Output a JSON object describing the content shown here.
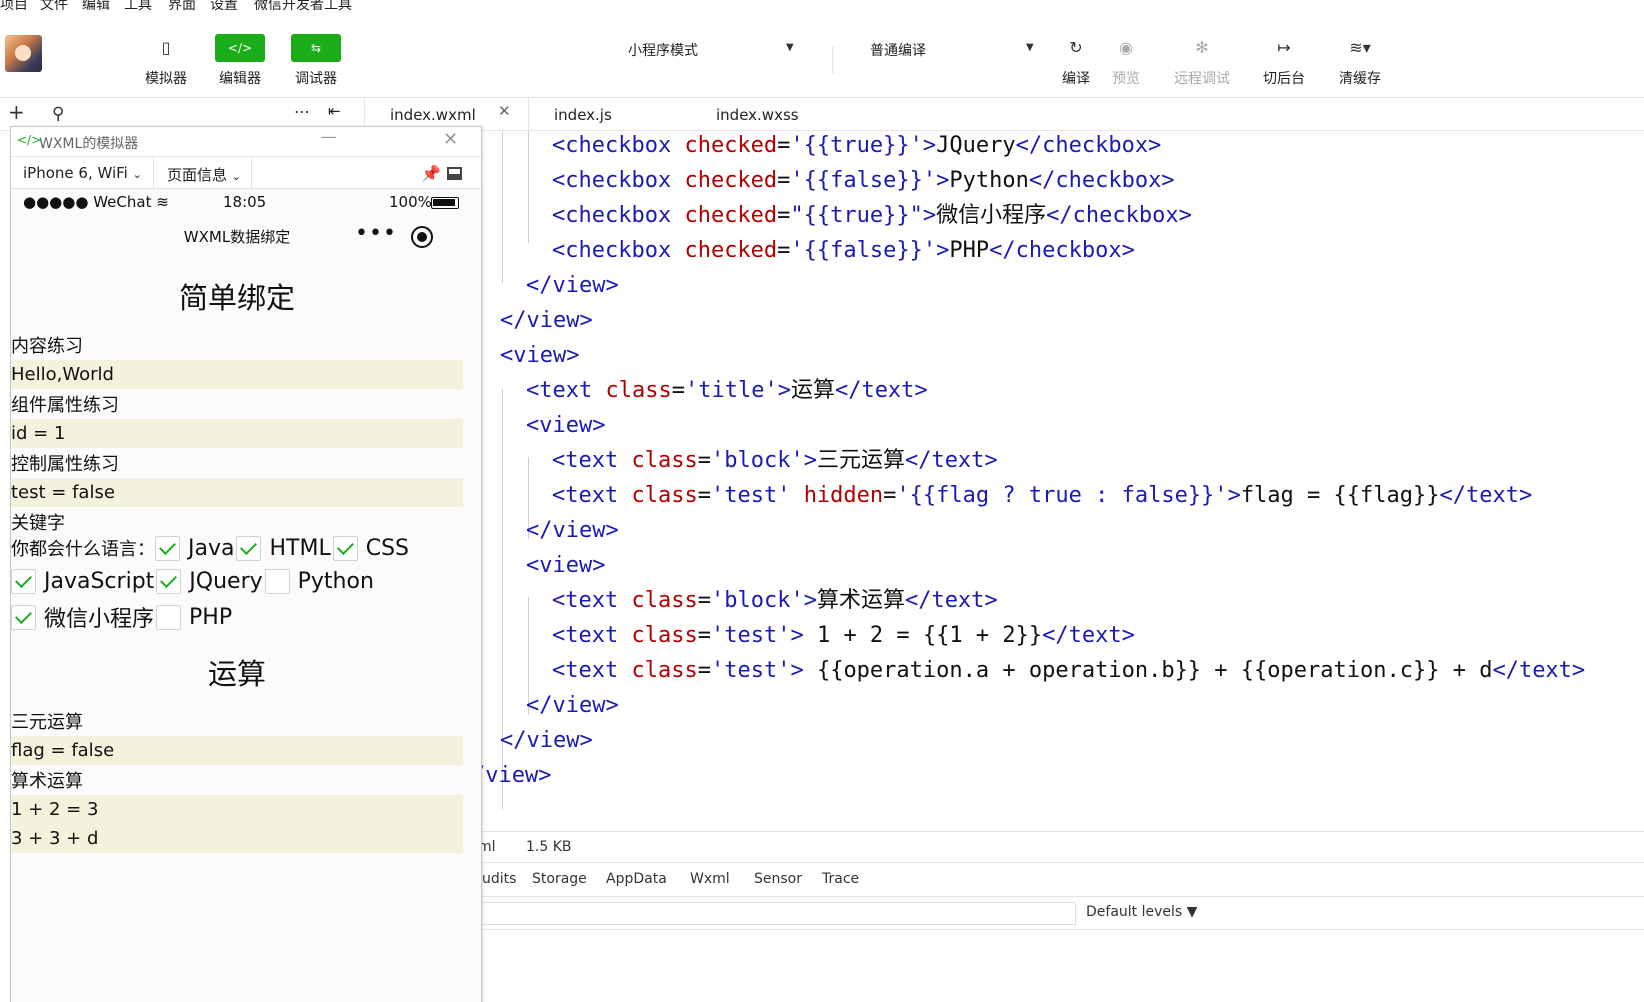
{
  "menu": [
    "项目",
    "文件",
    "编辑",
    "工具",
    "界面",
    "设置",
    "微信开发者工具"
  ],
  "toolbar": {
    "simulator": "模拟器",
    "editor": "编辑器",
    "debugger": "调试器",
    "mode": "小程序模式",
    "compile_mode": "普通编译",
    "compile": "编译",
    "preview": "预览",
    "remote_debug": "远程调试",
    "background": "切后台",
    "clear_cache": "清缓存"
  },
  "tabs": [
    "index.wxml",
    "index.js",
    "index.wxss"
  ],
  "simulator": {
    "title": "WXML的模拟器",
    "device": "iPhone 6, WiFi",
    "page_info": "页面信息",
    "carrier": "WeChat",
    "time": "18:05",
    "battery": "100%",
    "nav_title": "WXML数据绑定",
    "section1": "简单绑定",
    "content_label": "内容练习",
    "content_value": "Hello,World",
    "component_label": "组件属性练习",
    "component_value": "id = 1",
    "control_label": "控制属性练习",
    "control_value": "test = false",
    "keyword_label": "关键字",
    "lang_question": "你都会什么语言：",
    "langs": [
      "Java",
      "HTML",
      "CSS",
      "JavaScript",
      "JQuery",
      "Python",
      "微信小程序",
      "PHP"
    ],
    "section2": "运算",
    "ternary_label": "三元运算",
    "ternary_value": "flag = false",
    "arith_label": "算术运算",
    "arith_value1": "1 + 2 = 3",
    "arith_value2": "3 + 3 + d"
  },
  "code_lines": [
    "<checkbox checked='{{true}}'>JQuery</checkbox>",
    "<checkbox checked='{{false}}'>Python</checkbox>",
    "<checkbox checked=\"{{true}}\">微信小程序</checkbox>",
    "<checkbox checked='{{false}}'>PHP</checkbox>",
    "</view>",
    "</view>",
    "<view>",
    "<text class='title'>运算</text>",
    "<view>",
    "<text class='block'>三元运算</text>",
    "<text class='test' hidden='{{flag ? true : false}}'>flag = {{flag}}</text>",
    "</view>",
    "<view>",
    "<text class='block'>算术运算</text>",
    "<text class='test'> 1 + 2 = {{1 + 2}}</text>",
    "<text class='test'> {{operation.a + operation.b}} + {{operation.c}} + d</text>",
    "</view>",
    "</view>",
    "/view>"
  ],
  "status": {
    "file_ext": "ml",
    "size": "1.5 KB"
  },
  "devtools_tabs": [
    "udits",
    "Storage",
    "AppData",
    "Wxml",
    "Sensor",
    "Trace"
  ],
  "console": {
    "levels": "Default levels ▼"
  }
}
